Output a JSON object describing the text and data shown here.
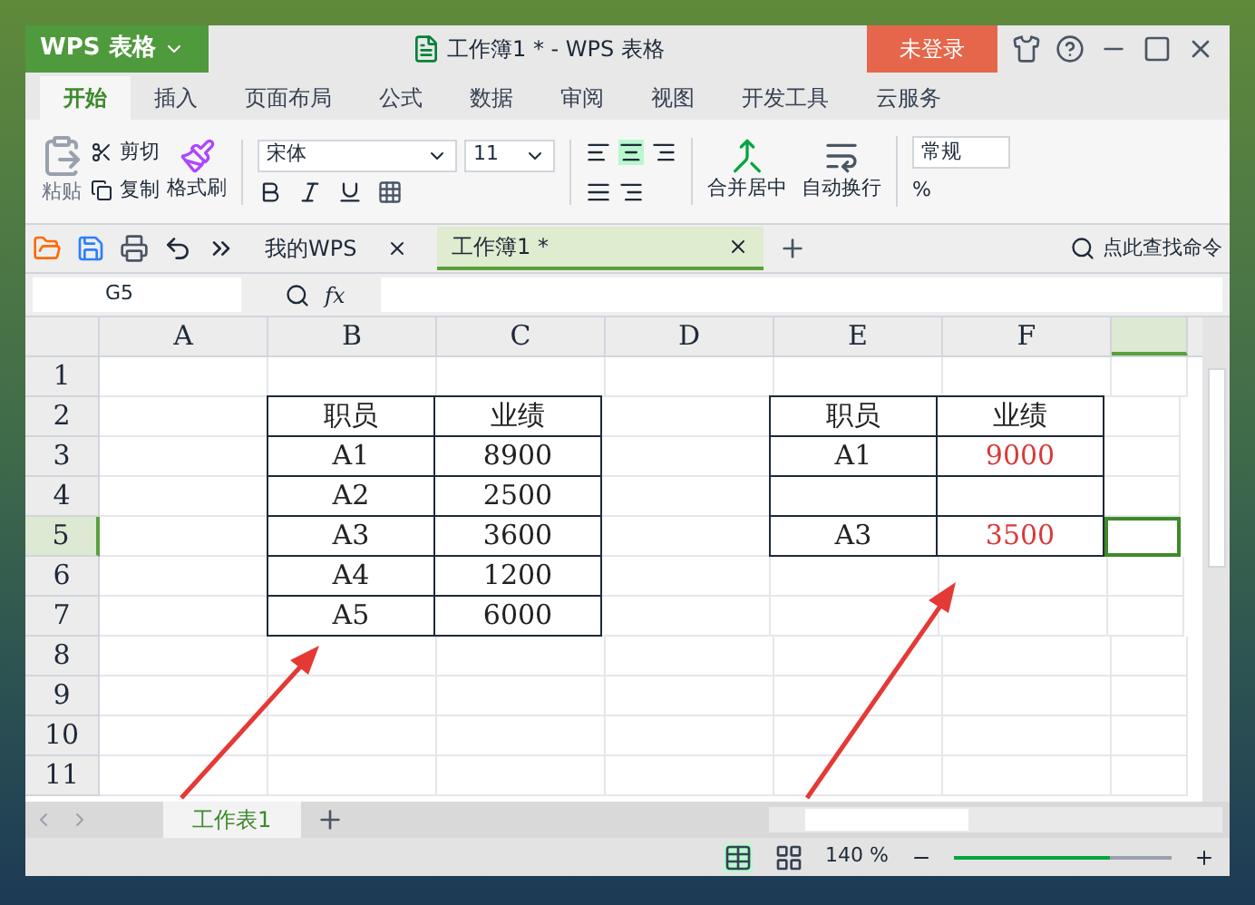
{
  "window": {
    "app_menu": "WPS 表格",
    "title": "工作簿1 * - WPS 表格",
    "login": "未登录"
  },
  "ribbon_tabs": [
    {
      "label": "开始",
      "selected": true
    },
    {
      "label": "插入",
      "selected": false
    },
    {
      "label": "页面布局",
      "selected": false
    },
    {
      "label": "公式",
      "selected": false
    },
    {
      "label": "数据",
      "selected": false
    },
    {
      "label": "审阅",
      "selected": false
    },
    {
      "label": "视图",
      "selected": false
    },
    {
      "label": "开发工具",
      "selected": false
    },
    {
      "label": "云服务",
      "selected": false
    }
  ],
  "ribbon": {
    "paste": "粘贴",
    "cut": "剪切",
    "copy": "复制",
    "format_painter": "格式刷",
    "font": "宋体",
    "font_size": "11",
    "merge": "合并居中",
    "wrap": "自动换行",
    "number_format": "常规",
    "percent": "%"
  },
  "doc_tabs": [
    {
      "label": "我的WPS",
      "selected": false
    },
    {
      "label": "工作簿1 *",
      "selected": true
    }
  ],
  "command_search": "点此查找命令",
  "formula_bar": {
    "name_box": "G5",
    "function_label": "fx"
  },
  "sheet": {
    "columns": [
      {
        "label": "A",
        "selected": false
      },
      {
        "label": "B",
        "selected": false
      },
      {
        "label": "C",
        "selected": false
      },
      {
        "label": "D",
        "selected": false
      },
      {
        "label": "E",
        "selected": false
      },
      {
        "label": "F",
        "selected": false
      },
      {
        "selected": true
      }
    ],
    "rows": [
      {
        "label": "1",
        "selected": false,
        "cells": [
          null,
          null,
          null,
          null,
          null,
          null,
          null
        ]
      },
      {
        "label": "2",
        "selected": false,
        "cells": [
          null,
          {
            "text": "职员",
            "bordered": true
          },
          {
            "text": "业绩",
            "bordered": true
          },
          null,
          {
            "text": "职员",
            "bordered": true
          },
          {
            "text": "业绩",
            "bordered": true
          },
          null
        ]
      },
      {
        "label": "3",
        "selected": false,
        "cells": [
          null,
          {
            "text": "A1",
            "bordered": true
          },
          {
            "text": "8900",
            "bordered": true
          },
          null,
          {
            "text": "A1",
            "bordered": true
          },
          {
            "text": "9000",
            "bordered": true,
            "color": "#d93a3a"
          },
          null
        ]
      },
      {
        "label": "4",
        "selected": false,
        "cells": [
          null,
          {
            "text": "A2",
            "bordered": true
          },
          {
            "text": "2500",
            "bordered": true
          },
          null,
          {
            "bordered": true
          },
          {
            "bordered": true
          },
          null
        ]
      },
      {
        "label": "5",
        "selected": true,
        "cells": [
          null,
          {
            "text": "A3",
            "bordered": true
          },
          {
            "text": "3600",
            "bordered": true
          },
          null,
          {
            "text": "A3",
            "bordered": true
          },
          {
            "text": "3500",
            "bordered": true,
            "color": "#d93a3a"
          },
          null
        ]
      },
      {
        "label": "6",
        "selected": false,
        "cells": [
          null,
          {
            "text": "A4",
            "bordered": true
          },
          {
            "text": "1200",
            "bordered": true
          },
          null,
          null,
          null,
          null
        ]
      },
      {
        "label": "7",
        "selected": false,
        "cells": [
          null,
          {
            "text": "A5",
            "bordered": true
          },
          {
            "text": "6000",
            "bordered": true
          },
          null,
          null,
          null,
          null
        ]
      },
      {
        "label": "8",
        "selected": false,
        "cells": [
          null,
          null,
          null,
          null,
          null,
          null,
          null
        ]
      },
      {
        "label": "9",
        "selected": false,
        "cells": [
          null,
          null,
          null,
          null,
          null,
          null,
          null
        ]
      },
      {
        "label": "10",
        "selected": false,
        "cells": [
          null,
          null,
          null,
          null,
          null,
          null,
          null
        ]
      },
      {
        "label": "11",
        "selected": false,
        "cells": [
          null,
          null,
          null,
          null,
          null,
          null,
          null
        ]
      }
    ]
  },
  "sheet_tabs": [
    {
      "label": "工作表1",
      "selected": true
    }
  ],
  "status_bar": {
    "zoom": "140 %",
    "zoom_slider": {
      "level": 0.72
    }
  }
}
